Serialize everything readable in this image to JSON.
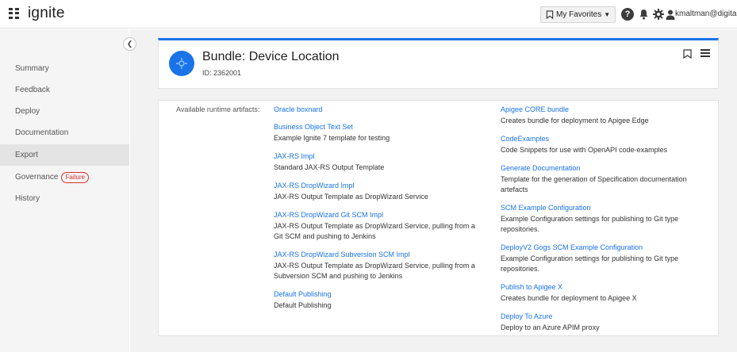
{
  "app": {
    "brand": "ignite"
  },
  "topbar": {
    "favorites_label": "My Favorites",
    "user_name": "kmaltman@digita",
    "icons": [
      "help-icon",
      "bell-icon",
      "gear-icon",
      "user-icon"
    ]
  },
  "sidebar": {
    "items": [
      {
        "label": "Summary"
      },
      {
        "label": "Feedback"
      },
      {
        "label": "Deploy"
      },
      {
        "label": "Documentation"
      },
      {
        "label": "Export"
      },
      {
        "label": "Governance",
        "badge": "Failure"
      },
      {
        "label": "History"
      }
    ],
    "active": "Export"
  },
  "bundle": {
    "title": "Bundle: Device Location",
    "id": "ID: 2362001"
  },
  "artifacts": {
    "label": "Available runtime artifacts:",
    "left": [
      {
        "name": "Oracle boxnard",
        "desc": ""
      },
      {
        "name": "Business Object Text Set",
        "desc": "Example Ignite 7 template for testing"
      },
      {
        "name": "JAX-RS Impl",
        "desc": "Standard JAX-RS Output Template"
      },
      {
        "name": "JAX-RS DropWizard Impl",
        "desc": "JAX-RS Output Template as DropWizard Service"
      },
      {
        "name": "JAX-RS DropWizard Git SCM Impl",
        "desc": "JAX-RS Output Template as DropWizard Service, pulling from a Git SCM and pushing to Jenkins"
      },
      {
        "name": "JAX-RS DropWizard Subversion SCM Impl",
        "desc": "JAX-RS Output Template as DropWizard Service, pulling from a Subversion SCM and pushing to Jenkins"
      },
      {
        "name": "Default Publishing",
        "desc": "Default Publishing"
      }
    ],
    "right": [
      {
        "name": "Apigee CORE bundle",
        "desc": "Creates bundle for deployment to Apigee Edge"
      },
      {
        "name": "CodeExamples",
        "desc": "Code Snippets for use with OpenAPI code-examples"
      },
      {
        "name": "Generate Documentation",
        "desc": "Template for the generation of Specification documentation artefacts"
      },
      {
        "name": "SCM Example Configuration",
        "desc": "Example Configuration settings for publishing to Git type repositories."
      },
      {
        "name": "DeployV2 Gogs SCM Example Configuration",
        "desc": "Example Configuration settings for publishing to Git type repositories."
      },
      {
        "name": "Publish to Apigee X",
        "desc": "Creates bundle for deployment to Apigee X"
      },
      {
        "name": "Deploy To Azure",
        "desc": "Deploy to an Azure APIM proxy"
      }
    ]
  }
}
